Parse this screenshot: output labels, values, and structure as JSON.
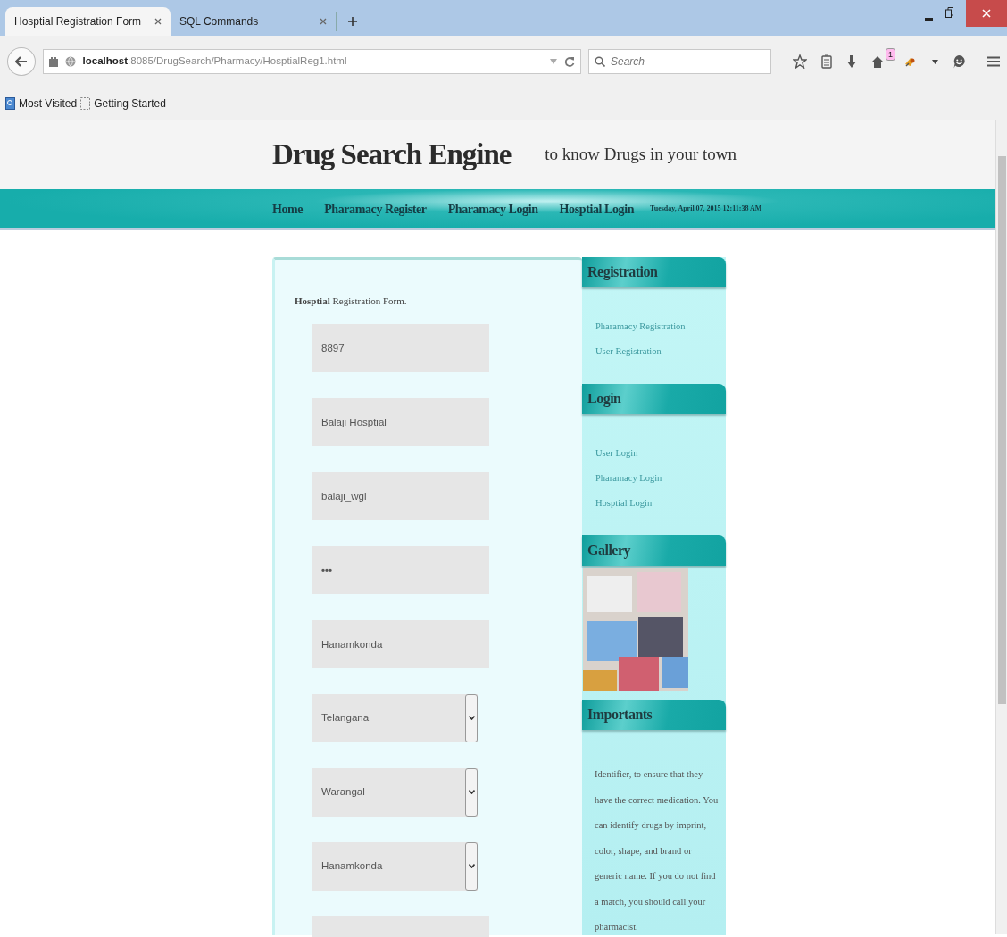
{
  "browser": {
    "tabs": [
      {
        "title": "Hosptial Registration Form",
        "selected": true
      },
      {
        "title": "SQL Commands",
        "selected": false
      }
    ],
    "url": "**localhost**:8085/DrugSearch/Pharmacy/HosptialReg1.html",
    "search": {
      "placeholder": "Search"
    },
    "notification_badge": "1",
    "bookmarks": [
      "Most Visited",
      "Getting Started"
    ]
  },
  "site": {
    "title": "Drug Search Engine",
    "tagline": "to know Drugs in your town",
    "nav": [
      {
        "label": "Home",
        "kind": "link"
      },
      {
        "label": "Pharamacy Register",
        "kind": "link"
      },
      {
        "label": "Pharamacy Login",
        "kind": "link"
      },
      {
        "label": "Hosptial Login",
        "kind": "link"
      },
      {
        "label": "Tuesday, April 07, 2015 12:11:38 AM",
        "kind": "clock"
      }
    ]
  },
  "form": {
    "heading": "**Hosptial** Registration Form.",
    "fields": [
      {
        "kind": "text",
        "value": "8897"
      },
      {
        "kind": "text",
        "value": "Balaji Hosptial"
      },
      {
        "kind": "text",
        "value": "balaji_wgl"
      },
      {
        "kind": "password",
        "value": "•••"
      },
      {
        "kind": "text",
        "value": "Hanamkonda"
      },
      {
        "kind": "select",
        "value": "Telangana"
      },
      {
        "kind": "select",
        "value": "Warangal"
      },
      {
        "kind": "select",
        "value": "Hanamkonda"
      },
      {
        "kind": "text"
      }
    ]
  },
  "sidebar": [
    {
      "heading": "Registration",
      "kind": "links",
      "items": [
        "Pharamacy Registration",
        "User Registration"
      ]
    },
    {
      "heading": "Login",
      "kind": "links",
      "items": [
        "User Login",
        "Pharamacy Login",
        "Hosptial Login"
      ]
    },
    {
      "heading": "Gallery",
      "kind": "gallery"
    },
    {
      "heading": "Importants",
      "kind": "text",
      "text": "Identifier, to ensure that they have the correct medication. You can identify drugs by imprint, color, shape, and brand or generic name. If you do not find a match, you should call your pharmacist."
    }
  ]
}
